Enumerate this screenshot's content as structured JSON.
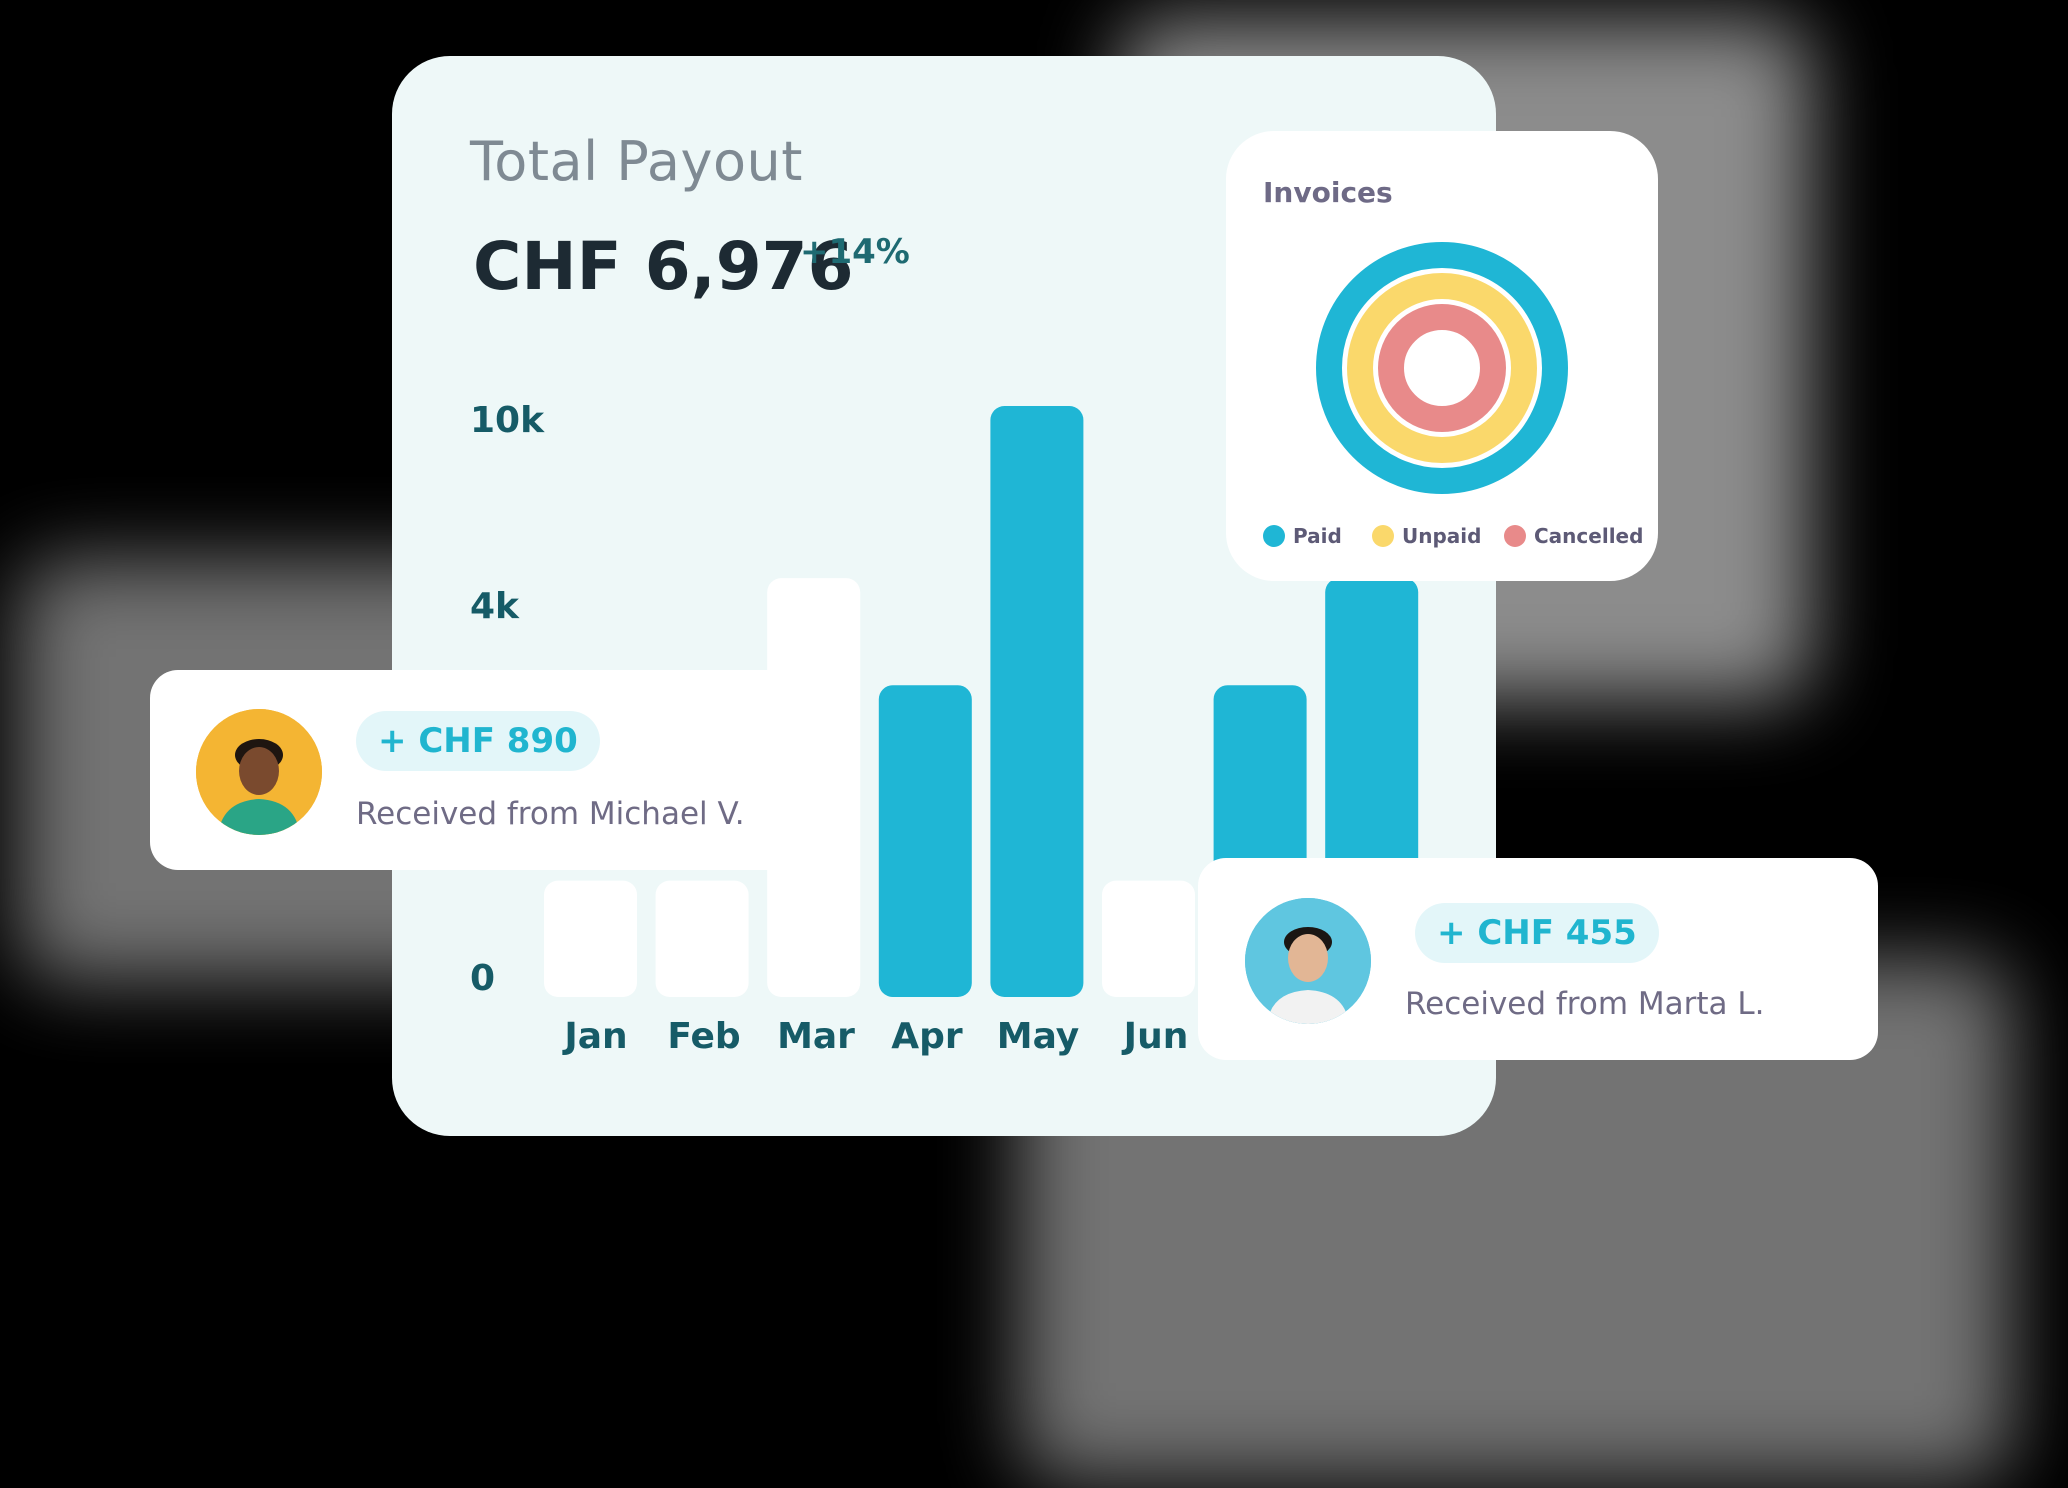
{
  "payout": {
    "title": "Total Payout",
    "amount": "CHF 6,976",
    "change": "+14%"
  },
  "chart_data": {
    "type": "bar",
    "y_tick_labels": [
      "10k",
      "4k",
      "0"
    ],
    "categories": [
      "Jan",
      "Feb",
      "Mar",
      "Apr",
      "May",
      "Jun",
      "",
      ""
    ],
    "values": [
      1250,
      1250,
      4500,
      3350,
      6350,
      1250,
      3350,
      4500
    ],
    "bar_colors": [
      "#ffffff",
      "#ffffff",
      "#ffffff",
      "#1fb6d5",
      "#1fb6d5",
      "#ffffff",
      "#1fb6d5",
      "#1fb6d5"
    ],
    "ylim": [
      0,
      6350
    ],
    "grid": false
  },
  "invoices": {
    "title": "Invoices",
    "legend": [
      {
        "label": "Paid",
        "color": "#1fb6d5"
      },
      {
        "label": "Unpaid",
        "color": "#fad86b"
      },
      {
        "label": "Cancelled",
        "color": "#e88a8a"
      }
    ]
  },
  "transactions": [
    {
      "amount": "+ CHF 890",
      "text": "Received from Michael V.",
      "avatar_bg": "#f4b533"
    },
    {
      "amount": "+ CHF 455",
      "text": "Received from Marta L.",
      "avatar_bg": "#5fc6e0"
    }
  ],
  "colors": {
    "accent": "#1fb6d5",
    "dark_teal": "#165b67"
  }
}
